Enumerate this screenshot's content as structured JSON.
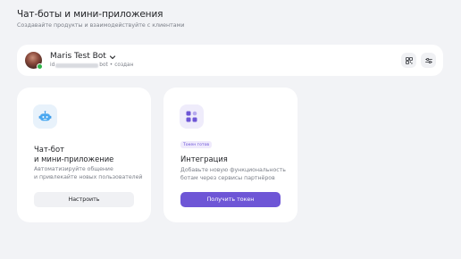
{
  "page": {
    "title": "Чат-боты и мини-приложения",
    "subtitle": "Создавайте продукты и взаимодействуйте с клиентами"
  },
  "bot": {
    "name": "Maris Test Bot",
    "id_prefix": "id",
    "id_suffix": "bot",
    "status_separator": "•",
    "status": "создан",
    "status_color": "#2fb54a"
  },
  "cards": {
    "chatbot": {
      "title_line1": "Чат-бот",
      "title_line2": "и мини-приложение",
      "desc_line1": "Автоматизируйте общение",
      "desc_line2": "и привлекайте новых пользователей",
      "button_label": "Настроить",
      "icon": "robot-icon"
    },
    "integration": {
      "tag": "Токен готов",
      "title": "Интеграция",
      "desc_line1": "Добавьте новую функциональность",
      "desc_line2": "ботам через сервисы партнёров",
      "button_label": "Получить токен",
      "icon": "apps-icon"
    }
  },
  "colors": {
    "accent": "#6e56d6",
    "background": "#f2f3f6"
  }
}
